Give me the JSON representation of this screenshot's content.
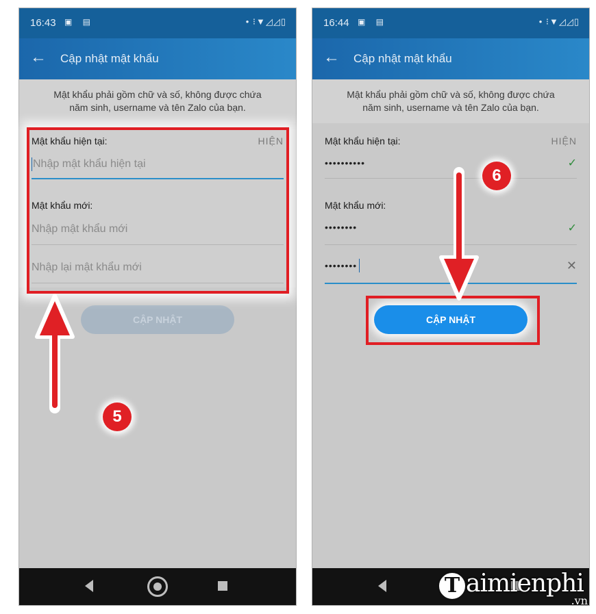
{
  "screens": [
    {
      "status": {
        "time": "16:43",
        "icons": "▣ ▤",
        "net": "• ⁝▼◿◿▯"
      },
      "appbar": {
        "back_icon": "←",
        "title": "Cập nhật mật khẩu"
      },
      "note": {
        "line1": "Mật khẩu phải gồm chữ và số, không được chứa",
        "line2": "năm sinh, username và tên Zalo của bạn."
      },
      "current_password": {
        "label": "Mật khẩu hiện tại:",
        "show": "HIỆN",
        "placeholder": "Nhập mật khẩu hiện tại"
      },
      "new_password": {
        "label": "Mật khẩu mới:",
        "placeholder": "Nhập mật khẩu mới",
        "confirm_placeholder": "Nhập lại mật khẩu mới"
      },
      "button": "CẬP NHẬT",
      "step_badge": "5"
    },
    {
      "status": {
        "time": "16:44",
        "icons": "▣ ▤",
        "net": "• ⁝▼◿◿▯"
      },
      "appbar": {
        "back_icon": "←",
        "title": "Cập nhật mật khẩu"
      },
      "note": {
        "line1": "Mật khẩu phải gồm chữ và số, không được chứa",
        "line2": "năm sinh, username và tên Zalo của bạn."
      },
      "current_password": {
        "label": "Mật khẩu hiện tại:",
        "show": "HIỆN",
        "value": "••••••••••",
        "check": "✓"
      },
      "new_password": {
        "label": "Mật khẩu mới:",
        "value": "••••••••",
        "check": "✓",
        "confirm_value": "••••••••",
        "clear": "✕"
      },
      "button": "CẬP NHẬT",
      "step_badge": "6"
    }
  ],
  "watermark": {
    "logo_letter": "T",
    "text": "aimienphi",
    "suffix": ".vn"
  },
  "colors": {
    "appbar": "#1b67ab",
    "button_active": "#1a8ee9",
    "highlight": "#e01e24",
    "arrow": "#e02025"
  }
}
